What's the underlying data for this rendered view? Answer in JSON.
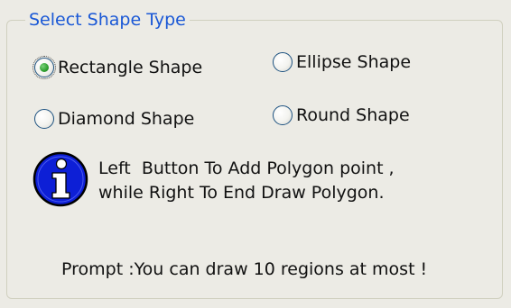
{
  "group": {
    "title": "Select Shape Type"
  },
  "shapes": [
    {
      "label": "Rectangle Shape",
      "checked": true
    },
    {
      "label": "Ellipse Shape",
      "checked": false
    },
    {
      "label": "Diamond Shape",
      "checked": false
    },
    {
      "label": "Round Shape",
      "checked": false
    }
  ],
  "info": {
    "icon": "info-icon",
    "line1": "Left  Button To Add Polygon point ,",
    "line2": "while Right To End Draw Polygon."
  },
  "prompt": "Prompt :You can draw 10 regions at most !",
  "colors": {
    "title": "#1a58d6",
    "icon_fill": "#0d1fd6",
    "background": "#ecebe5"
  }
}
